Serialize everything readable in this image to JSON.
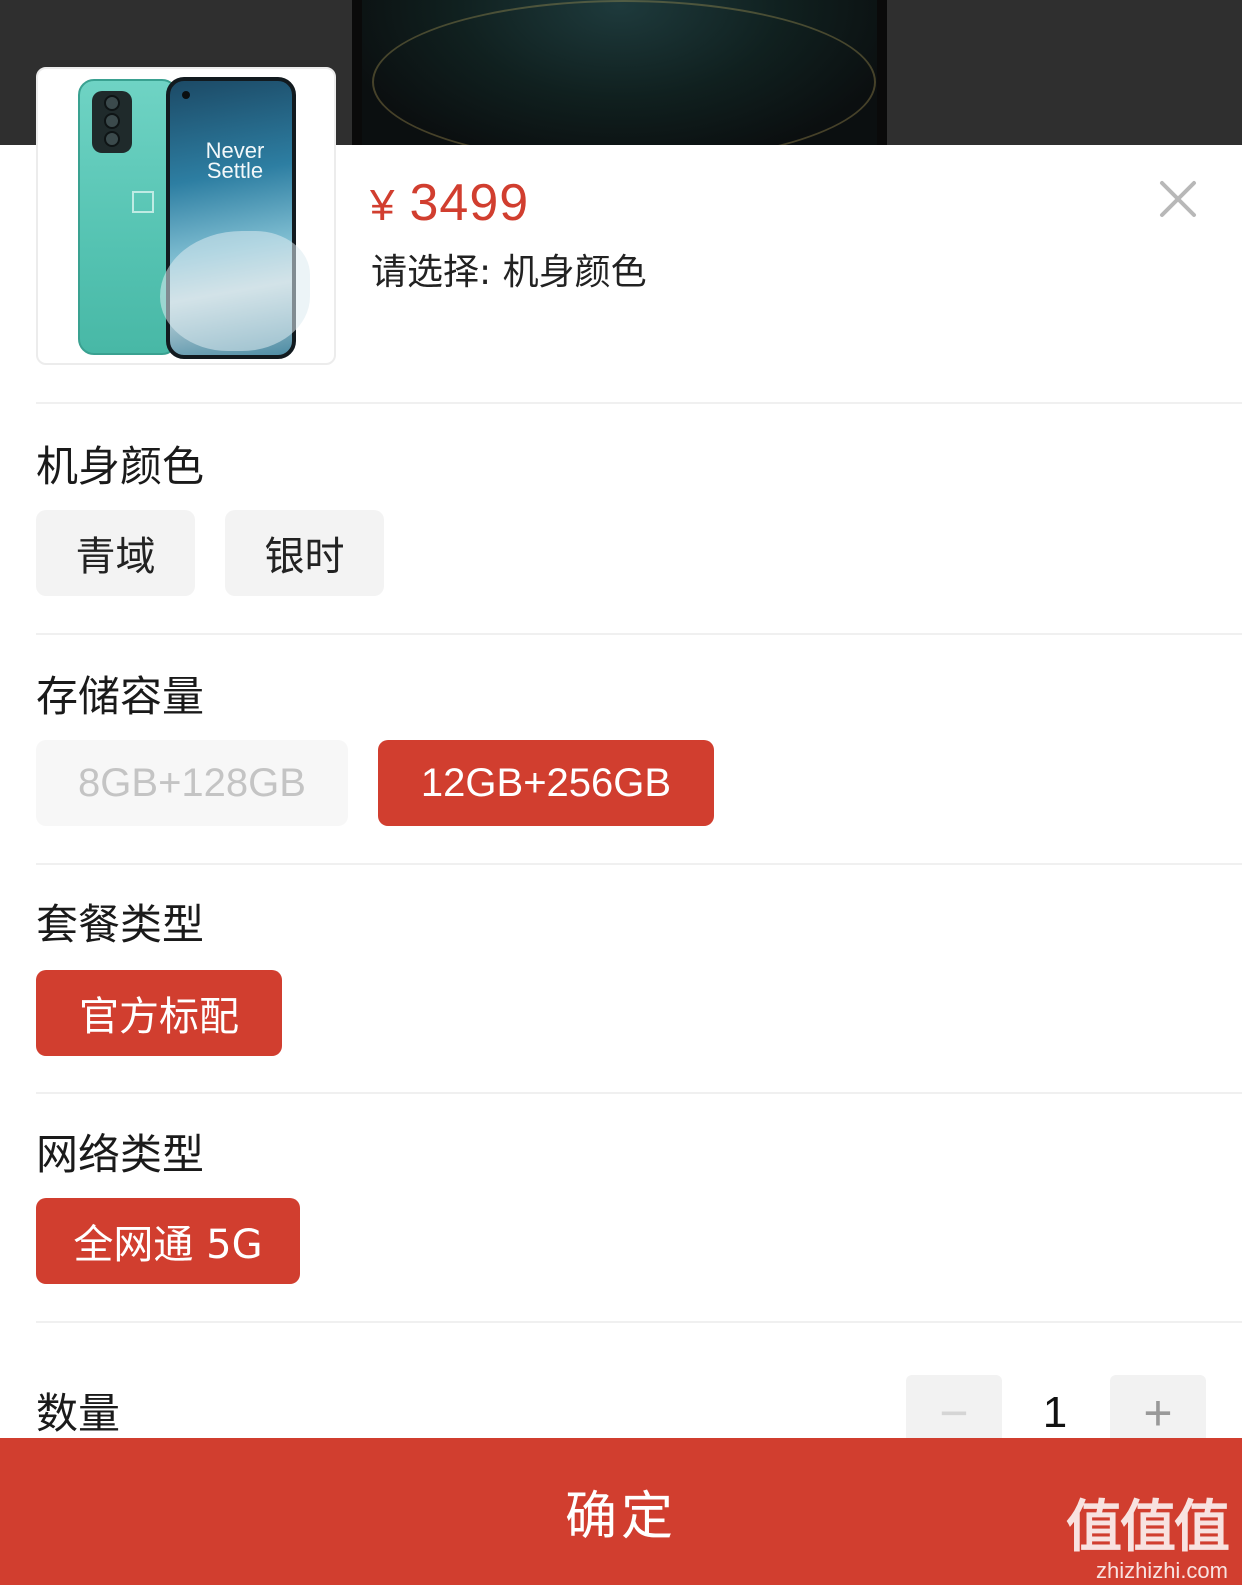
{
  "product": {
    "currency": "¥",
    "price": "3499",
    "select_hint": "请选择: 机身颜色",
    "image_text": "Never Settle"
  },
  "sections": {
    "color": {
      "title": "机身颜色",
      "options": [
        "青域",
        "银时"
      ]
    },
    "storage": {
      "title": "存储容量",
      "options": [
        "8GB+128GB",
        "12GB+256GB"
      ],
      "selected": "12GB+256GB",
      "disabled": "8GB+128GB"
    },
    "package": {
      "title": "套餐类型",
      "options": [
        "官方标配"
      ],
      "selected": "官方标配"
    },
    "network": {
      "title": "网络类型",
      "options": [
        "全网通 5G"
      ],
      "selected": "全网通 5G"
    }
  },
  "quantity": {
    "label": "数量",
    "value": "1",
    "minus": "−",
    "plus": "+"
  },
  "confirm_label": "确定",
  "watermark": {
    "title": "值值值",
    "url": "zhizhizhi.com"
  },
  "colors": {
    "accent": "#d13e2f",
    "chip_bg": "#f3f3f3",
    "disabled_text": "#c4c4c4"
  }
}
